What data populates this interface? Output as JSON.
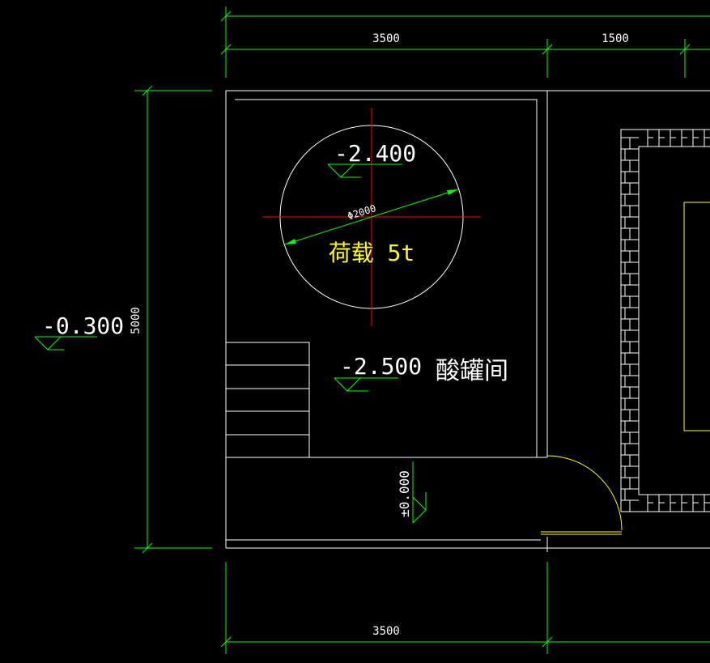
{
  "dimensions": {
    "top_left": "3500",
    "top_right": "1500",
    "left_height": "5000",
    "bottom": "3500"
  },
  "elevations": {
    "outside": "-0.300",
    "tank": "-2.400",
    "room": "-2.500",
    "corridor": "±0.000"
  },
  "tank": {
    "diameter": "Φ2000",
    "load": "荷载 5t"
  },
  "room_name": "酸罐间",
  "colors": {
    "background": "#000000",
    "dimension": "#00ff00",
    "wall": "#ffffff",
    "centerline": "#ff0000",
    "door": "#ffff00",
    "load_text": "#ffff00"
  }
}
